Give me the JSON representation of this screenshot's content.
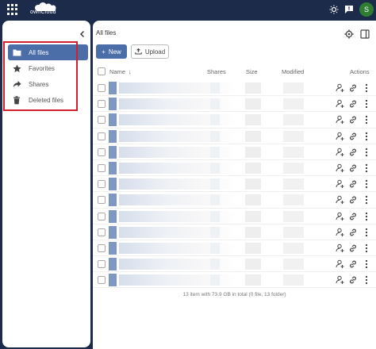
{
  "header": {
    "logo_text": "ownCloud",
    "avatar_initial": "S",
    "icons": [
      "apps-grid-icon",
      "theme-toggle-icon",
      "feedback-icon"
    ]
  },
  "sidebar": {
    "items": [
      {
        "label": "All files",
        "icon": "folder-icon",
        "active": true
      },
      {
        "label": "Favorites",
        "icon": "star-icon",
        "active": false
      },
      {
        "label": "Shares",
        "icon": "share-icon",
        "active": false
      },
      {
        "label": "Deleted files",
        "icon": "trash-icon",
        "active": false
      }
    ],
    "highlight_color": "#d3202a"
  },
  "main": {
    "breadcrumb": "All files",
    "new_button": "New",
    "upload_button": "Upload",
    "columns": {
      "name": "Name",
      "shares": "Shares",
      "size": "Size",
      "modified": "Modified",
      "actions": "Actions"
    },
    "footer": "13 item with 73.9 GB in total (0 file, 13 folder)"
  },
  "colors": {
    "topbar": "#1c2b4a",
    "accent": "#4b6ea8"
  }
}
